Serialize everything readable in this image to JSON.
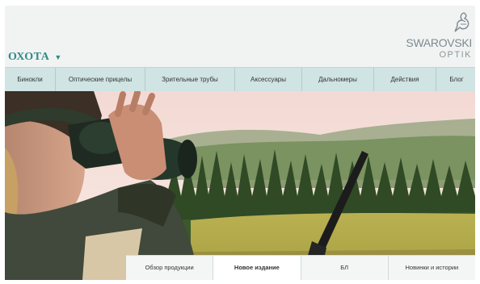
{
  "header": {
    "section_title": "ОХОТА",
    "brand_name": "SWAROVSKI",
    "brand_sub": "OPTIK",
    "logo_icon": "swan-logo-icon",
    "dropdown_icon": "chevron-down-icon"
  },
  "nav": {
    "items": [
      {
        "label": "Бинокли"
      },
      {
        "label": "Оптические прицелы"
      },
      {
        "label": "Зрительные трубы"
      },
      {
        "label": "Аксессуары"
      },
      {
        "label": "Дальномеры"
      },
      {
        "label": "Действия"
      },
      {
        "label": "Блог"
      }
    ]
  },
  "subnav": {
    "items": [
      {
        "label": "Обзор продукции"
      },
      {
        "label": "Новое издание"
      },
      {
        "label": "БЛ"
      },
      {
        "label": "Новинки и истории"
      }
    ],
    "active_index": 1
  },
  "colors": {
    "accent": "#2f8a86",
    "nav_background": "#cfe4e3",
    "brand_text": "#7d8a8c"
  }
}
